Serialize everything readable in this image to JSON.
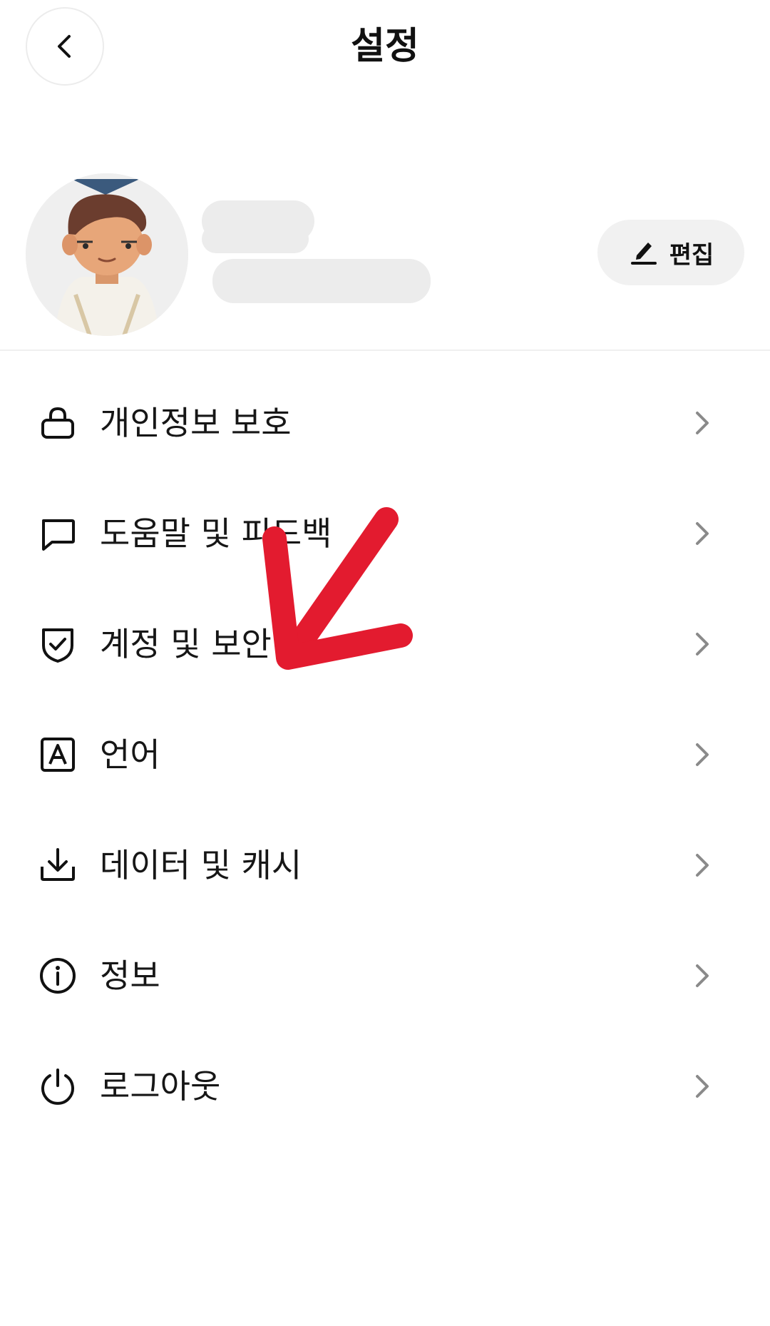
{
  "header": {
    "title": "설정",
    "back_icon": "chevron-left-icon"
  },
  "profile": {
    "edit_label": "편집",
    "edit_icon": "pencil-icon"
  },
  "menu": {
    "items": [
      {
        "label": "개인정보 보호",
        "icon": "lock-icon"
      },
      {
        "label": "도움말 및 피드백",
        "icon": "chat-bubble-icon"
      },
      {
        "label": "계정 및 보안",
        "icon": "shield-check-icon"
      },
      {
        "label": "언어",
        "icon": "language-icon"
      },
      {
        "label": "데이터 및 캐시",
        "icon": "download-icon"
      },
      {
        "label": "정보",
        "icon": "info-icon"
      },
      {
        "label": "로그아웃",
        "icon": "power-icon"
      }
    ]
  },
  "colors": {
    "annotation": "#e31b2f",
    "text": "#161616",
    "chevron": "#8a8a8a"
  }
}
